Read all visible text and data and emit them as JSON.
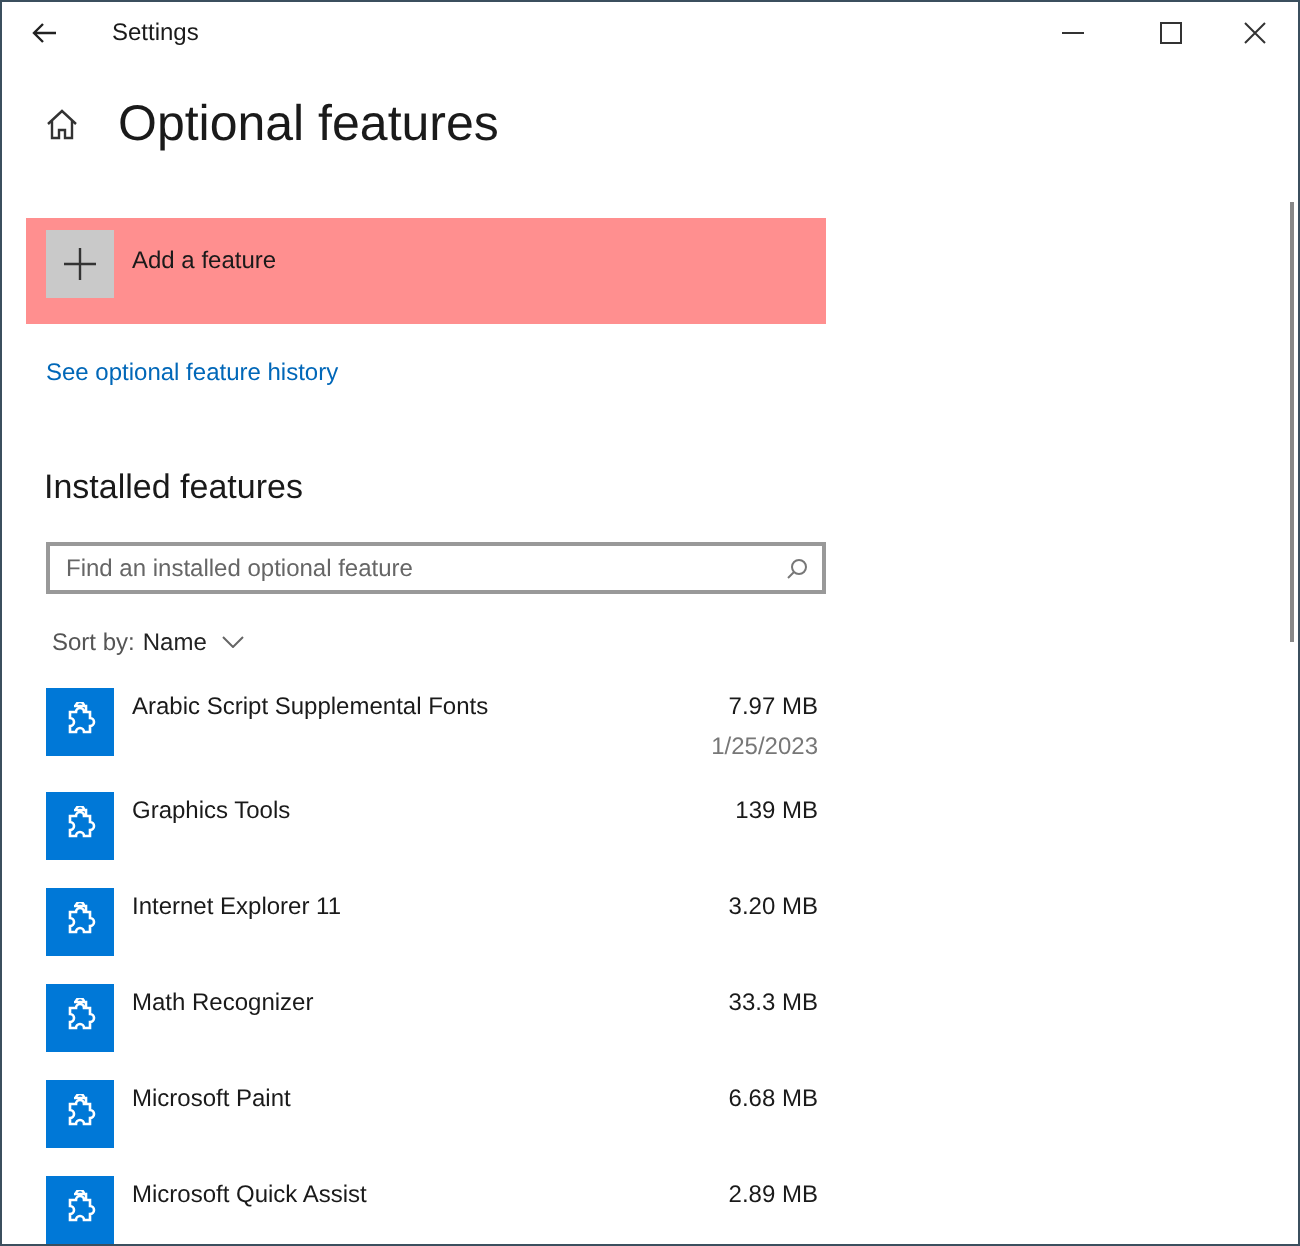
{
  "window": {
    "title": "Settings"
  },
  "page": {
    "title": "Optional features"
  },
  "add_feature": {
    "label": "Add a feature"
  },
  "history_link": "See optional feature history",
  "installed": {
    "heading": "Installed features",
    "search": {
      "placeholder": "Find an installed optional feature"
    },
    "sort": {
      "label": "Sort by:",
      "value": "Name"
    }
  },
  "features": [
    {
      "name": "Arabic Script Supplemental Fonts",
      "size": "7.97 MB",
      "date": "1/25/2023"
    },
    {
      "name": "Graphics Tools",
      "size": "139 MB"
    },
    {
      "name": "Internet Explorer 11",
      "size": "3.20 MB"
    },
    {
      "name": "Math Recognizer",
      "size": "33.3 MB"
    },
    {
      "name": "Microsoft Paint",
      "size": "6.68 MB"
    },
    {
      "name": "Microsoft Quick Assist",
      "size": "2.89 MB"
    }
  ]
}
